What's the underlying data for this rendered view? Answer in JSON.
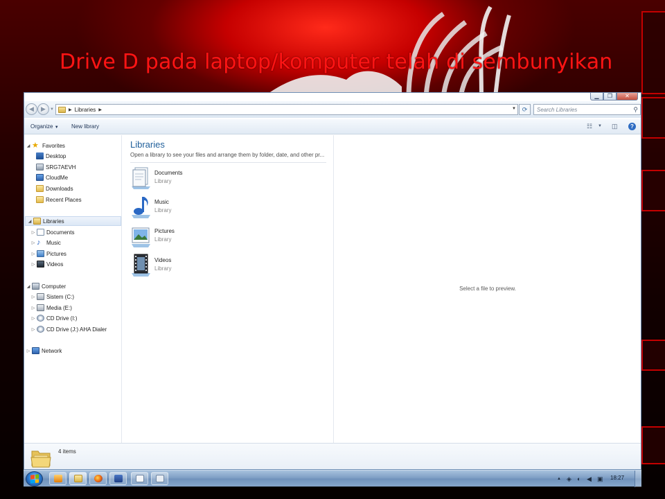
{
  "slide": {
    "title": "Drive D pada laptop/komputer telah di sembunyikan"
  },
  "window": {
    "address_path": [
      "Libraries"
    ],
    "search_placeholder": "Search Libraries",
    "toolbar": {
      "organize_label": "Organize",
      "new_library_label": "New library"
    }
  },
  "nav_pane": {
    "favorites": {
      "label": "Favorites",
      "items": [
        {
          "label": "Desktop",
          "icon": "desktop-icon"
        },
        {
          "label": "SRG7AEVH",
          "icon": "computer-icon"
        },
        {
          "label": "CloudMe",
          "icon": "cloud-folder-icon"
        },
        {
          "label": "Downloads",
          "icon": "downloads-folder-icon"
        },
        {
          "label": "Recent Places",
          "icon": "recent-places-icon"
        }
      ]
    },
    "libraries": {
      "label": "Libraries",
      "items": [
        {
          "label": "Documents",
          "icon": "documents-icon"
        },
        {
          "label": "Music",
          "icon": "music-icon"
        },
        {
          "label": "Pictures",
          "icon": "pictures-icon"
        },
        {
          "label": "Videos",
          "icon": "videos-icon"
        }
      ]
    },
    "computer": {
      "label": "Computer",
      "items": [
        {
          "label": "Sistem (C:)",
          "icon": "hard-drive-icon"
        },
        {
          "label": "Media (E:)",
          "icon": "hard-drive-icon"
        },
        {
          "label": "CD Drive (I:)",
          "icon": "cd-drive-icon"
        },
        {
          "label": "CD Drive (J:) AHA Dialer",
          "icon": "cd-drive-icon"
        }
      ]
    },
    "network": {
      "label": "Network"
    }
  },
  "content": {
    "title": "Libraries",
    "subtitle": "Open a library to see your files and arrange them by folder, date, and other pr...",
    "libraries": [
      {
        "name": "Documents",
        "type": "Library",
        "icon": "documents-library-icon"
      },
      {
        "name": "Music",
        "type": "Library",
        "icon": "music-library-icon"
      },
      {
        "name": "Pictures",
        "type": "Library",
        "icon": "pictures-library-icon"
      },
      {
        "name": "Videos",
        "type": "Library",
        "icon": "videos-library-icon"
      }
    ]
  },
  "preview": {
    "text": "Select a file to preview."
  },
  "details": {
    "item_count": "4 items"
  },
  "taskbar": {
    "clock": "18:27"
  },
  "colors": {
    "slide_title": "#ff1414",
    "accent_red": "#c40000",
    "library_title": "#1e5e9a"
  }
}
